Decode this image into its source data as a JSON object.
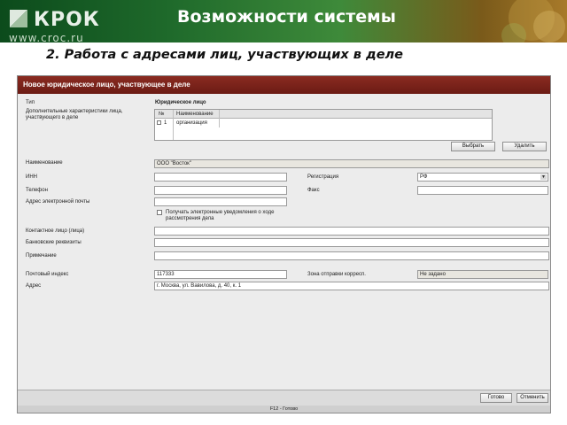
{
  "slide": {
    "logo_text": "КРОК",
    "logo_url": "www.croc.ru",
    "title": "Возможности системы",
    "subtitle": "2. Работа с адресами лиц, участвующих в деле"
  },
  "form": {
    "header": "Новое юридическое лицо, участвующее в деле",
    "type": {
      "label": "Тип",
      "value": "Юридическое лицо"
    },
    "characteristics": {
      "label": "Дополнительные характеристики лица, участвующего в деле",
      "columns": [
        "№",
        "Наименование"
      ],
      "rows": [
        {
          "num": "1",
          "name": "организация"
        }
      ],
      "select_button": "Выбрать",
      "delete_button": "Удалить"
    },
    "name": {
      "label": "Наименование",
      "value": "ООО \"Восток\""
    },
    "inn": {
      "label": "ИНН",
      "value": ""
    },
    "registration": {
      "label": "Регистрация",
      "value": "РФ"
    },
    "phone": {
      "label": "Телефон",
      "value": ""
    },
    "fax": {
      "label": "Факс",
      "value": ""
    },
    "email": {
      "label": "Адрес электронной почты",
      "value": ""
    },
    "notify": {
      "label": "Получать электронные уведомления о ходе рассмотрения дела",
      "checked": false
    },
    "contact": {
      "label": "Контактное лицо (лица)",
      "value": ""
    },
    "bank": {
      "label": "Банковские реквизиты",
      "value": ""
    },
    "note": {
      "label": "Примечание",
      "value": ""
    },
    "postal_index": {
      "label": "Почтовый индекс",
      "value": "117333"
    },
    "zone": {
      "label": "Зона отправки корресп.",
      "value": "Не задано"
    },
    "address": {
      "label": "Адрес",
      "value": "г. Москва, ул. Вавилова, д. 40, к. 1"
    },
    "ok_button": "Готово",
    "cancel_button": "Отменить",
    "status": "F12 - Готово"
  },
  "colors": {
    "header_bar": "#7a231a",
    "banner": "#1f6a2b"
  }
}
